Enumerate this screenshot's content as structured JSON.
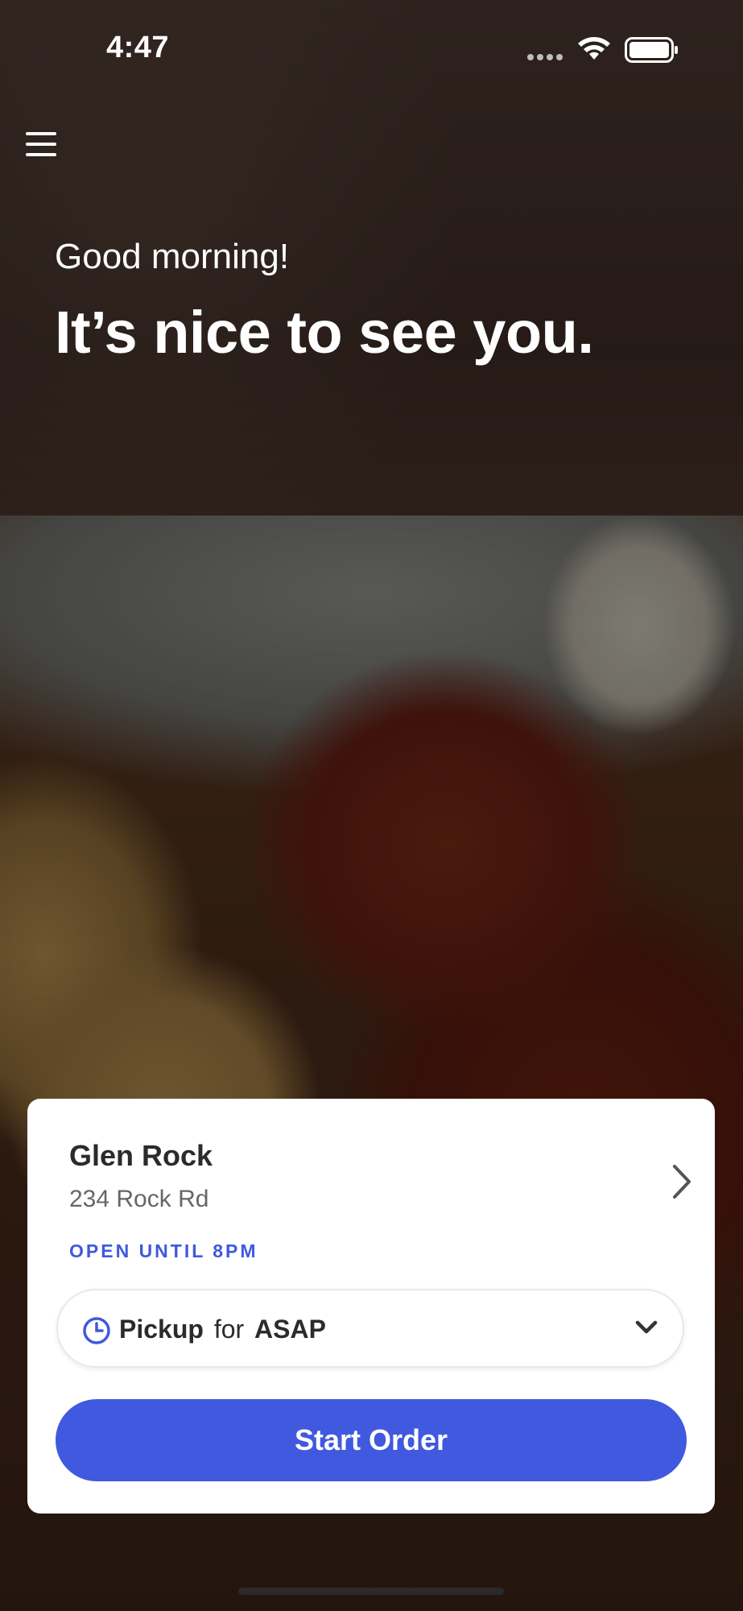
{
  "status_bar": {
    "time": "4:47"
  },
  "hero": {
    "greeting": "Good morning!",
    "headline": "It’s nice to see you."
  },
  "store": {
    "name": "Glen Rock",
    "address": "234 Rock Rd",
    "status": "OPEN UNTIL 8PM"
  },
  "order_mode": {
    "mode": "Pickup",
    "connector": "for",
    "time": "ASAP"
  },
  "actions": {
    "start_order": "Start Order"
  },
  "colors": {
    "accent": "#4159de",
    "text": "#2b2b2b",
    "subtext": "#666666"
  },
  "icons": [
    "menu-icon",
    "chevron-right-icon",
    "clock-icon",
    "chevron-down-icon",
    "wifi-icon",
    "battery-icon",
    "signal-icon"
  ]
}
